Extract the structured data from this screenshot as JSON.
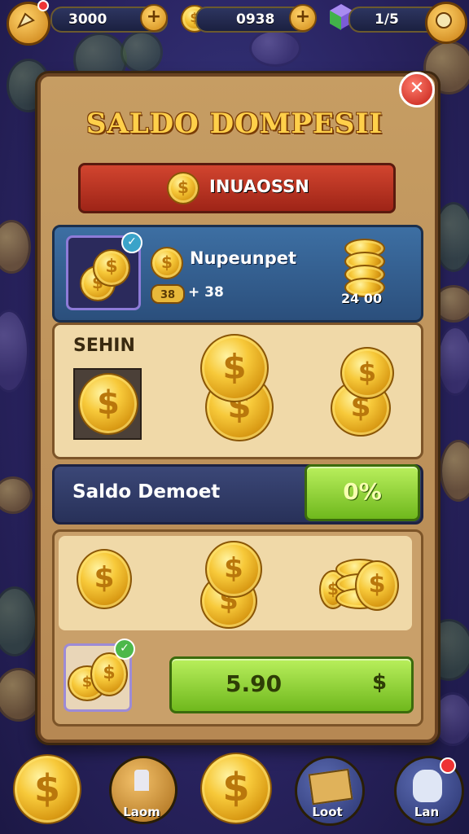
{
  "top_bar": {
    "coins_value": "3000",
    "cash_value": "0938",
    "gems_value": "1/5"
  },
  "dialog": {
    "title": "SALDO DOMPESII",
    "red_banner_label": "INUAOSSN",
    "deposit_card": {
      "title": "Nupeunpet",
      "chip_value": "38",
      "multiplier_text": "+ 38",
      "amount_text": "24 00"
    },
    "section_label": "SEHIN",
    "balance_label": "Saldo Demoet",
    "balance_percent": "0%",
    "buy_button": {
      "amount": "5.90",
      "currency": "$"
    }
  },
  "bottom_nav": {
    "items": [
      {
        "label": ""
      },
      {
        "label": "Laom"
      },
      {
        "label": ""
      },
      {
        "label": "Loot"
      },
      {
        "label": "Lan"
      }
    ]
  },
  "colors": {
    "accent_gold": "#ffd04a",
    "panel": "#c69d63",
    "red_banner": "#d2452f",
    "green_button": "#8fd42f",
    "navy": "#2b3560"
  }
}
